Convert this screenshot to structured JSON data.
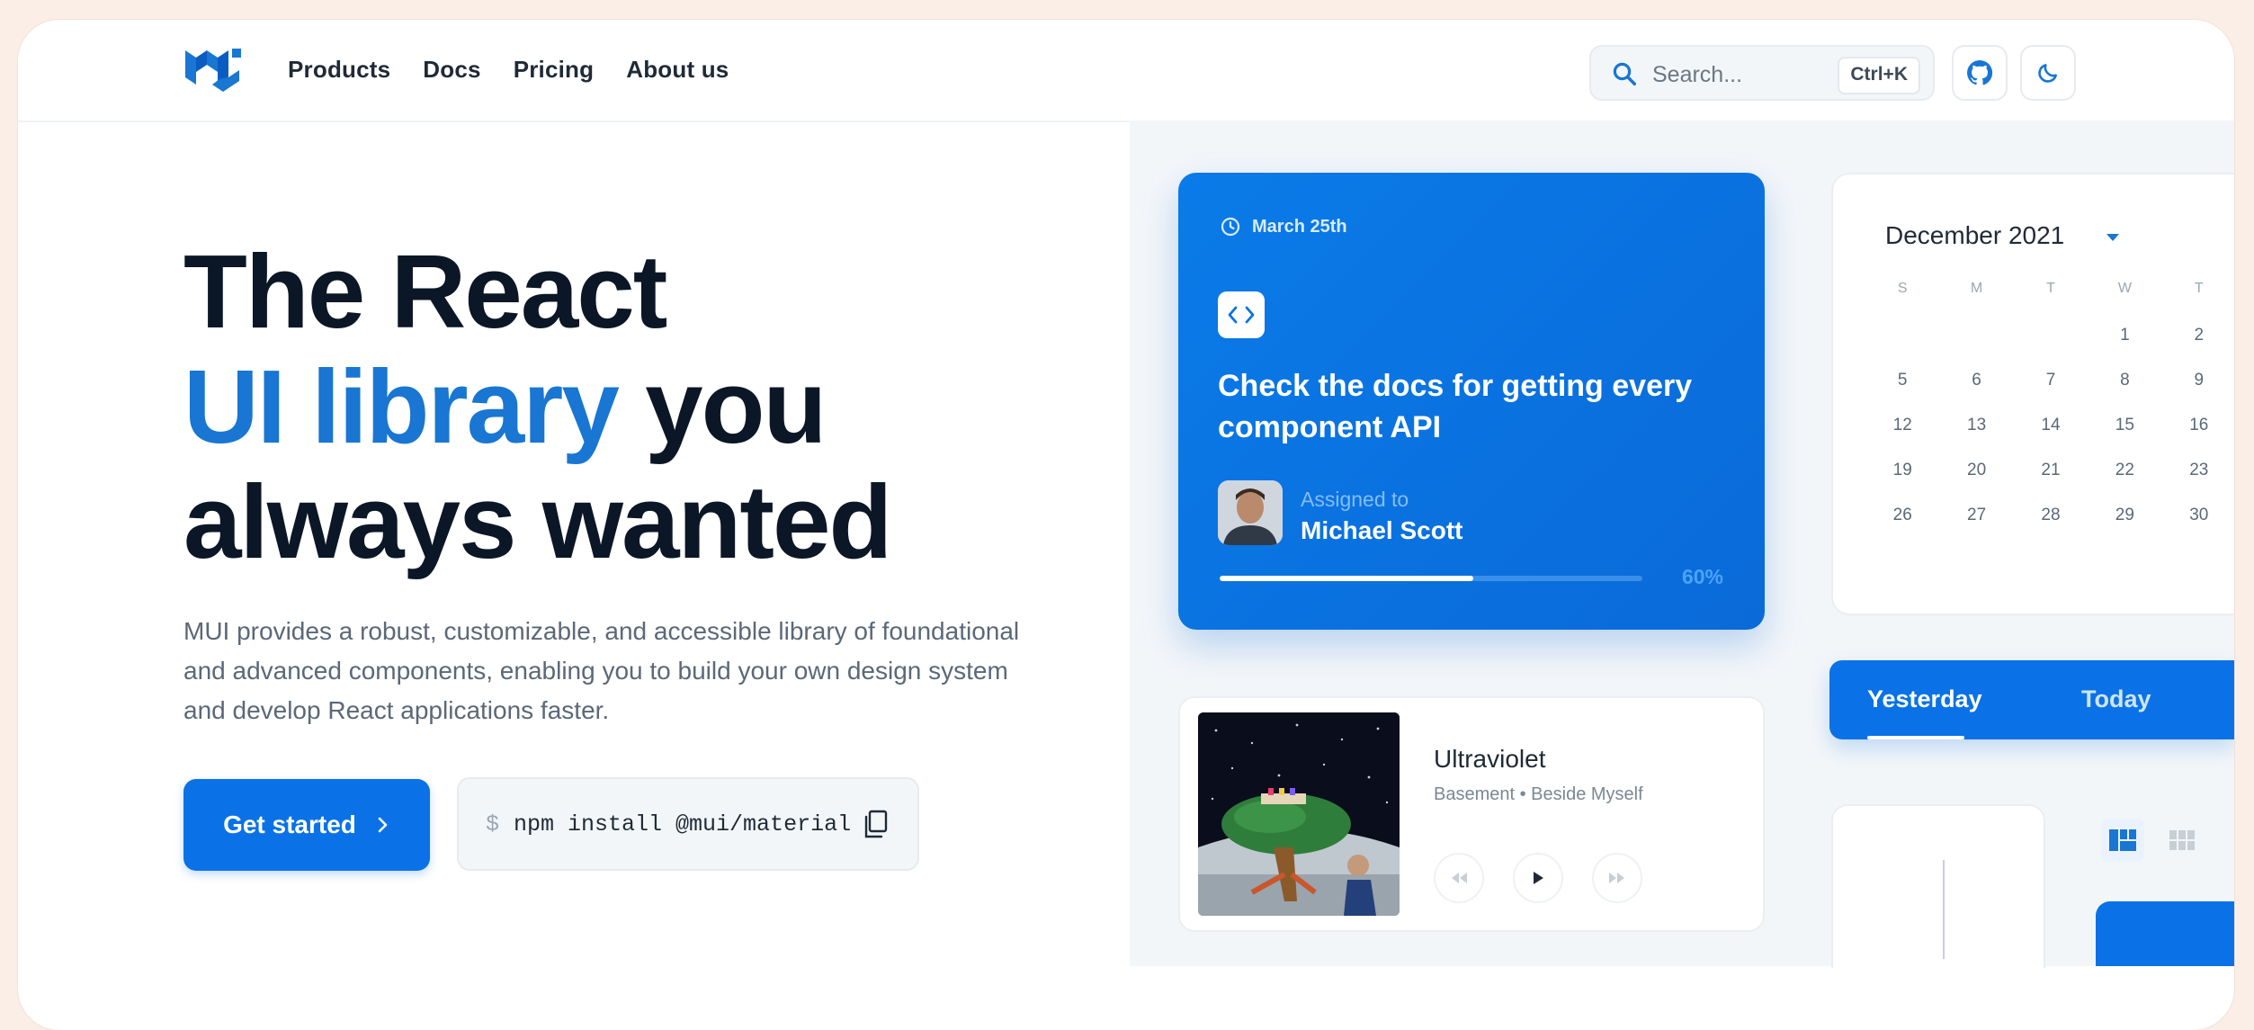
{
  "nav": {
    "items": [
      "Products",
      "Docs",
      "Pricing",
      "About us"
    ]
  },
  "search": {
    "placeholder": "Search...",
    "shortcut": "Ctrl+K"
  },
  "hero": {
    "title_line1": "The React",
    "title_highlight": "UI library",
    "title_rest": " you",
    "title_line3": "always wanted",
    "description": "MUI provides a robust, customizable, and accessible library of foundational and advanced components, enabling you to build your own design system and develop React applications faster.",
    "cta_label": "Get started",
    "install_prompt": "$",
    "install_command": "npm install @mui/material"
  },
  "task_card": {
    "date": "March 25th",
    "title": "Check the docs for getting every component API",
    "assigned_label": "Assigned to",
    "assignee": "Michael Scott",
    "progress_label": "60%",
    "progress": 0.6
  },
  "calendar": {
    "month": "December 2021",
    "weekdays": [
      "S",
      "M",
      "T",
      "W",
      "T"
    ],
    "weeks": [
      [
        "",
        "",
        "",
        "1",
        "2"
      ],
      [
        "5",
        "6",
        "7",
        "8",
        "9"
      ],
      [
        "12",
        "13",
        "14",
        "15",
        "16"
      ],
      [
        "19",
        "20",
        "21",
        "22",
        "23"
      ],
      [
        "26",
        "27",
        "28",
        "29",
        "30"
      ]
    ]
  },
  "tabs": {
    "items": [
      "Yesterday",
      "Today"
    ]
  },
  "player": {
    "song": "Ultraviolet",
    "artist": "Basement • Beside Myself"
  },
  "colors": {
    "brand": "#1976d2",
    "primary": "#0a72e6",
    "heading": "#0b1726"
  },
  "icons": {
    "logo": "mui-logo",
    "search": "search-icon",
    "github": "github-icon",
    "theme": "moon-icon",
    "copy": "copy-icon",
    "clock": "clock-icon",
    "code": "code-icon",
    "caret": "caret-down-icon",
    "prev": "skip-previous-icon",
    "play": "play-icon",
    "next": "skip-next-icon"
  }
}
